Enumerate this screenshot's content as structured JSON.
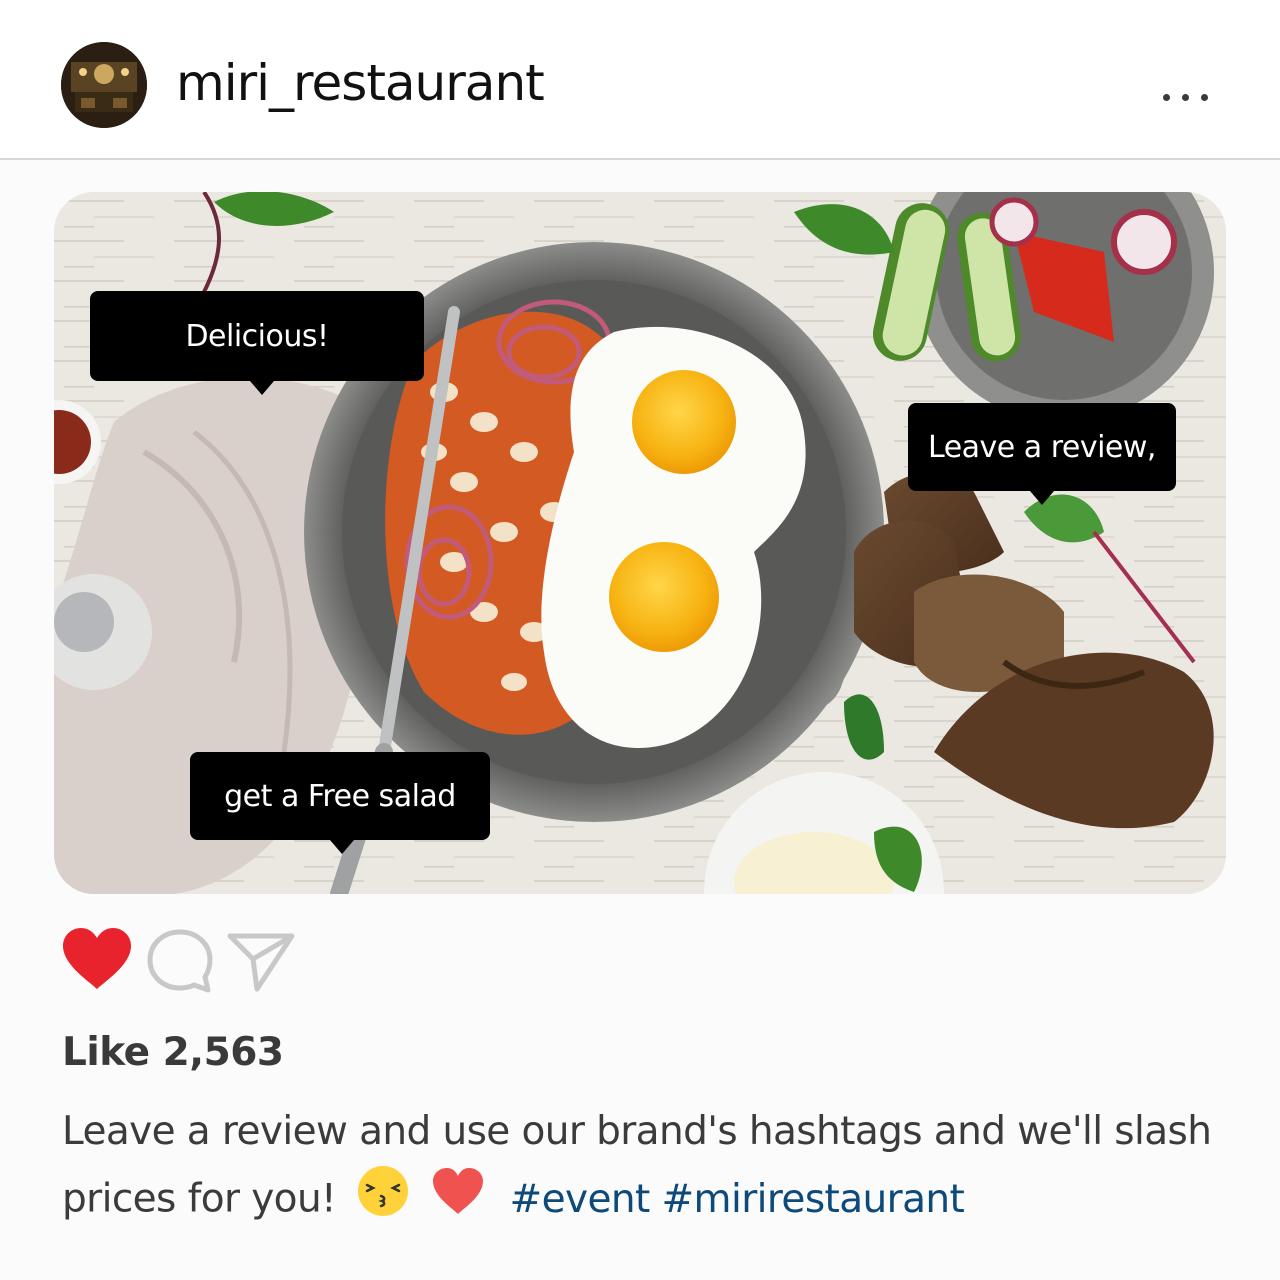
{
  "header": {
    "username": "miri_restaurant",
    "avatar_icon": "restaurant-interior-avatar",
    "more_icon": "more-horizontal-icon"
  },
  "photo": {
    "bubbles": [
      {
        "text": "Delicious!"
      },
      {
        "text": "Leave a review,"
      },
      {
        "text": "get a Free salad"
      }
    ]
  },
  "actions": {
    "like_icon": "heart-icon",
    "like_color": "#e8232e",
    "comment_icon": "comment-icon",
    "share_icon": "send-icon"
  },
  "likes": {
    "text": "Like 2,563"
  },
  "caption": {
    "line1": "Leave a review and use our brand's hashtags and we'll slash",
    "line2": "prices for you!",
    "emojis": [
      "kissing-face-icon",
      "red-heart-icon"
    ],
    "hashtags": "#event #mirirestaurant",
    "hashtag_color": "#0d4a7a"
  }
}
